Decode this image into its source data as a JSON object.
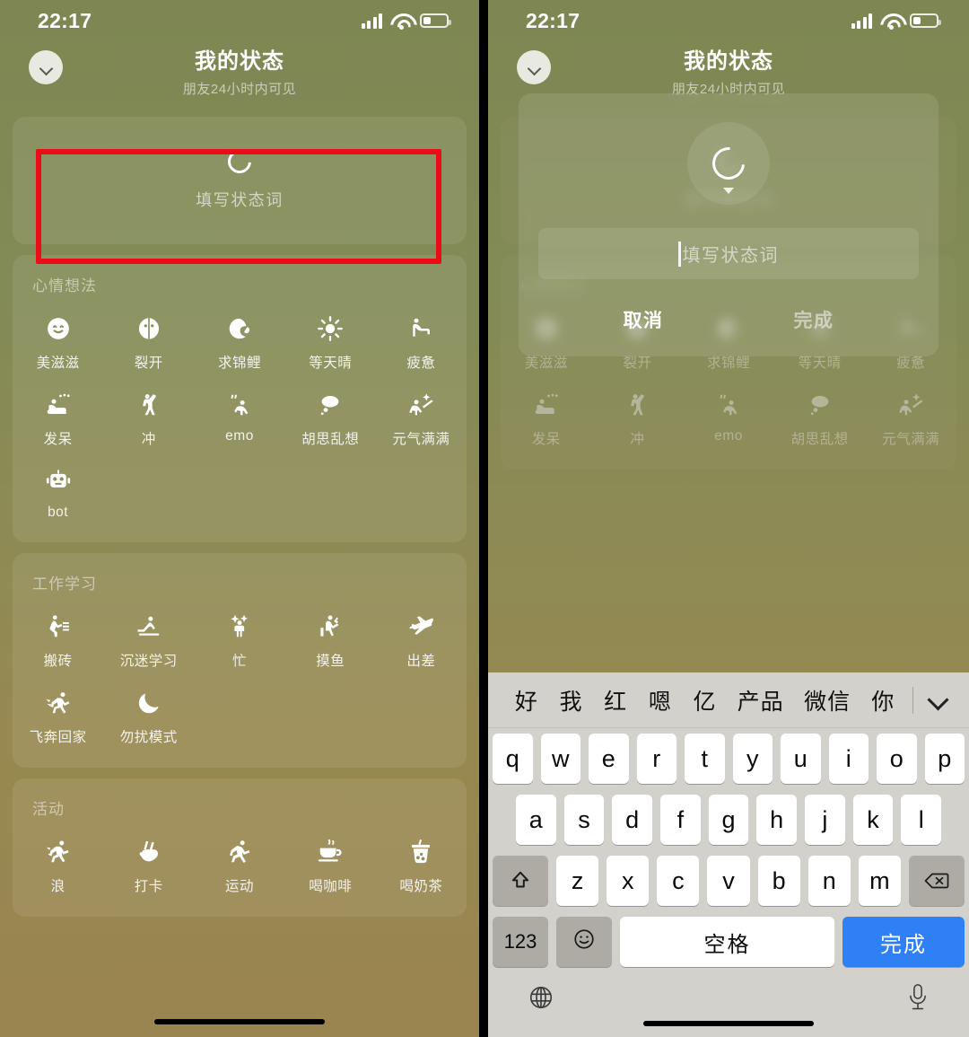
{
  "status_bar": {
    "time": "22:17",
    "signal": "signal-bars",
    "wifi": "wifi-icon",
    "battery": "battery-low-icon"
  },
  "nav": {
    "collapse_icon": "chevron-down-icon",
    "title": "我的状态",
    "subtitle": "朋友24小时内可见"
  },
  "composer": {
    "icon": "status-ring-icon",
    "placeholder": "填写状态词"
  },
  "sections": [
    {
      "title": "心情想法",
      "items": [
        {
          "label": "美滋滋",
          "icon": "smiley-face-icon",
          "glyph": "☺"
        },
        {
          "label": "裂开",
          "icon": "cracked-face-icon",
          "glyph": "☻"
        },
        {
          "label": "求锦鲤",
          "icon": "koi-fish-icon",
          "glyph": "🜛"
        },
        {
          "label": "等天晴",
          "icon": "sun-icon",
          "glyph": "☀"
        },
        {
          "label": "疲惫",
          "icon": "tired-person-icon",
          "glyph": "⛹"
        },
        {
          "label": "发呆",
          "icon": "daydreaming-icon",
          "glyph": "☁"
        },
        {
          "label": "冲",
          "icon": "cheering-person-icon",
          "glyph": "⚐"
        },
        {
          "label": "emo",
          "icon": "emo-person-icon",
          "glyph": "❝"
        },
        {
          "label": "胡思乱想",
          "icon": "thought-cloud-icon",
          "glyph": "☁"
        },
        {
          "label": "元气满满",
          "icon": "sparkle-star-icon",
          "glyph": "✨"
        },
        {
          "label": "bot",
          "icon": "robot-icon",
          "glyph": "🤖"
        }
      ]
    },
    {
      "title": "工作学习",
      "items": [
        {
          "label": "搬砖",
          "icon": "carrying-bricks-icon",
          "glyph": "🧱"
        },
        {
          "label": "沉迷学习",
          "icon": "studying-icon",
          "glyph": "📖"
        },
        {
          "label": "忙",
          "icon": "busy-person-icon",
          "glyph": "⚡"
        },
        {
          "label": "摸鱼",
          "icon": "slacking-icon",
          "glyph": "🐟"
        },
        {
          "label": "出差",
          "icon": "airplane-icon",
          "glyph": "✈"
        },
        {
          "label": "飞奔回家",
          "icon": "running-home-icon",
          "glyph": "🏃"
        },
        {
          "label": "勿扰模式",
          "icon": "moon-icon",
          "glyph": "🌙"
        }
      ]
    },
    {
      "title": "活动",
      "items": [
        {
          "label": "浪",
          "icon": "jumping-person-icon",
          "glyph": "🤸"
        },
        {
          "label": "打卡",
          "icon": "victory-hand-icon",
          "glyph": "✌"
        },
        {
          "label": "运动",
          "icon": "running-icon",
          "glyph": "🏃"
        },
        {
          "label": "喝咖啡",
          "icon": "coffee-cup-icon",
          "glyph": "☕"
        },
        {
          "label": "喝奶茶",
          "icon": "bubble-tea-icon",
          "glyph": "🧋"
        }
      ]
    }
  ],
  "annotation": {
    "type": "red-highlight-box",
    "target": "composer",
    "color": "#ec0b16"
  },
  "modal": {
    "avatar_icon": "status-ring-icon",
    "dropdown_icon": "caret-down-icon",
    "input_placeholder": "填写状态词",
    "input_value": "",
    "cancel_label": "取消",
    "done_label": "完成"
  },
  "keyboard": {
    "candidates": [
      "好",
      "我",
      "红",
      "嗯",
      "亿",
      "产品",
      "微信",
      "你"
    ],
    "expand_icon": "chevron-down-icon",
    "row1": [
      "q",
      "w",
      "e",
      "r",
      "t",
      "y",
      "u",
      "i",
      "o",
      "p"
    ],
    "row2": [
      "a",
      "s",
      "d",
      "f",
      "g",
      "h",
      "j",
      "k",
      "l"
    ],
    "row3": [
      "z",
      "x",
      "c",
      "v",
      "b",
      "n",
      "m"
    ],
    "shift_icon": "shift-icon",
    "backspace_icon": "backspace-icon",
    "numbers_label": "123",
    "emoji_icon": "emoji-icon",
    "space_label": "空格",
    "done_label": "完成",
    "globe_icon": "globe-icon",
    "mic_icon": "microphone-icon"
  },
  "colors": {
    "bg_top": "#7e8753",
    "bg_bottom": "#9a8450",
    "accent_blue": "#2f7ff5",
    "annotation_red": "#ec0b16"
  }
}
